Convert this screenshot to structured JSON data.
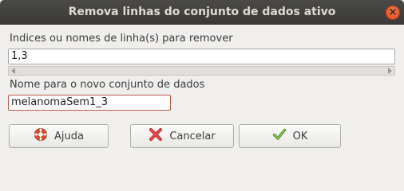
{
  "window": {
    "title": "Remova linhas do conjunto de dados ativo",
    "close_icon": "close-icon"
  },
  "form": {
    "rows_label": "Indices ou nomes de linha(s) para remover",
    "rows_value": "1,3",
    "newname_label": "Nome para o novo conjunto de dados",
    "newname_value": "melanomaSem1_3"
  },
  "buttons": {
    "help_label": "Ajuda",
    "cancel_label": "Cancelar",
    "ok_label": "OK"
  },
  "icons": {
    "help": "lifebuoy-icon",
    "cancel": "red-x-icon",
    "ok": "green-check-icon"
  },
  "colors": {
    "titlebar": "#3c3b37",
    "close_button": "#e9541f",
    "focus_border": "#c0584a"
  }
}
